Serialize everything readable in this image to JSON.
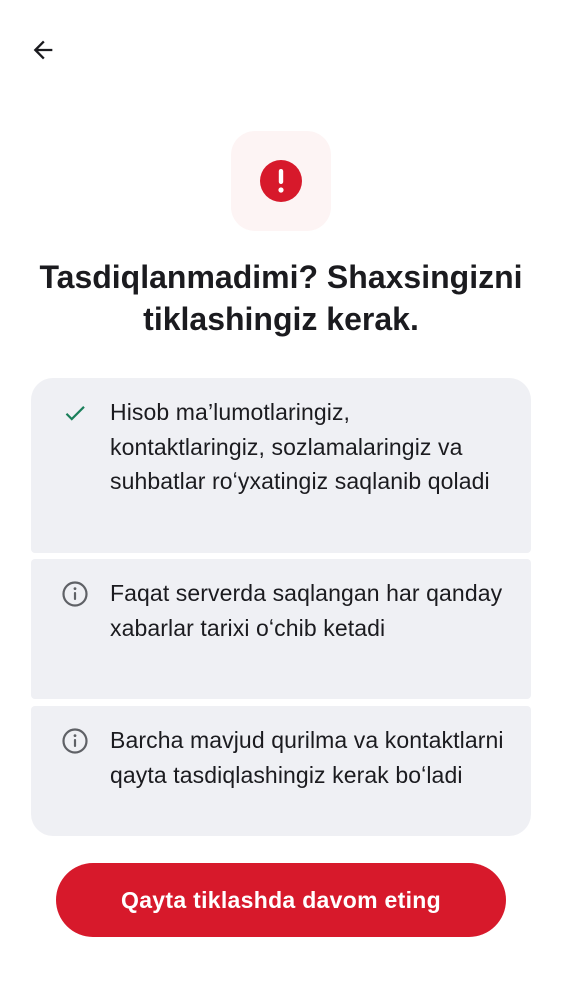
{
  "header": {
    "back_icon": "arrow-left-icon"
  },
  "alert": {
    "icon": "exclamation-circle-icon",
    "color": "#d7192b",
    "tile_color": "#fdf4f4"
  },
  "title": "Tasdiqlanmadimi? Shaxsingizni tiklashingiz kerak.",
  "info_cards": [
    {
      "icon": "check-icon",
      "icon_color": "#1a7f5a",
      "text": "Hisob ma’lumotlaringiz, kontaktlaringiz, sozlamalaringiz va suhbatlar roʻyxatingiz saqlanib qoladi"
    },
    {
      "icon": "info-icon",
      "icon_color": "#5f6166",
      "text": "Faqat serverda saqlangan har qanday xabarlar tarixi oʻchib ketadi"
    },
    {
      "icon": "info-icon",
      "icon_color": "#5f6166",
      "text": "Barcha mavjud qurilma va kontaktlarni qayta tasdiqlashingiz kerak boʻladi"
    }
  ],
  "primary_button": {
    "label": "Qayta tiklashda davom eting",
    "color": "#d7192b"
  }
}
